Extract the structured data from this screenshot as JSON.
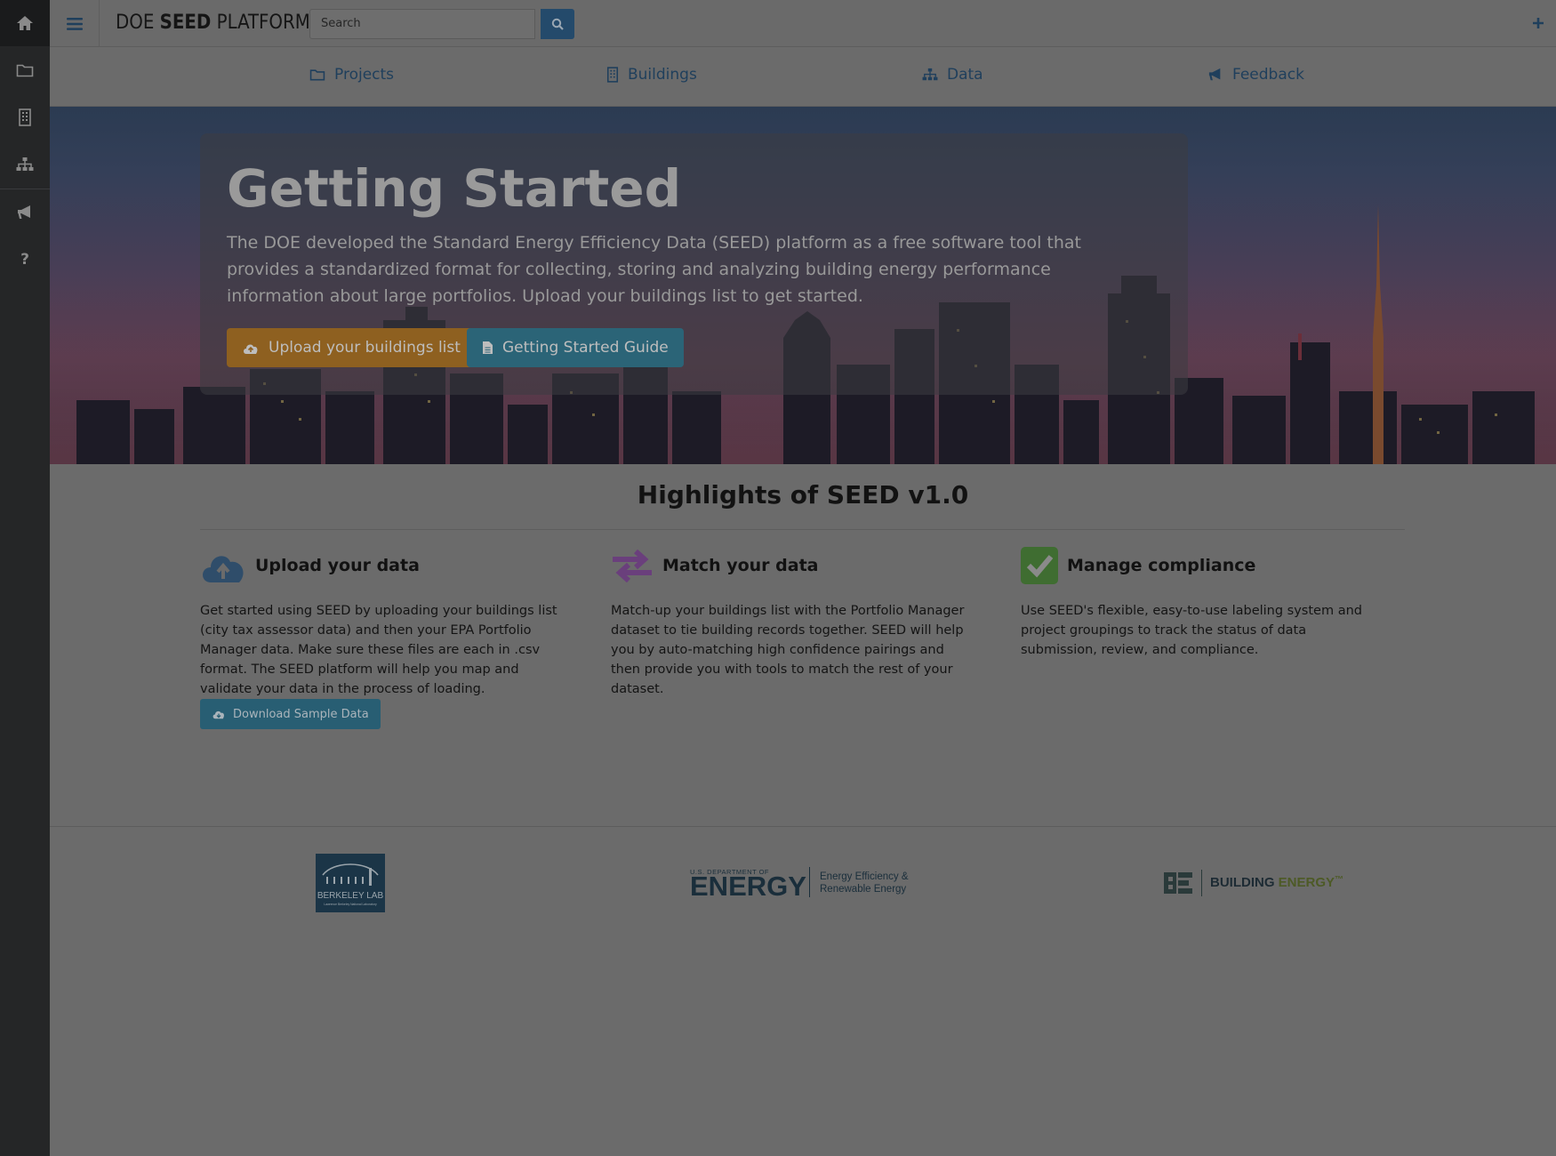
{
  "rail": {
    "items": [
      {
        "icon": "home-icon"
      },
      {
        "icon": "folder-icon"
      },
      {
        "icon": "building-icon"
      },
      {
        "icon": "sitemap-icon"
      },
      {
        "icon": "bullhorn-icon"
      },
      {
        "icon": "question-icon"
      }
    ]
  },
  "topbar": {
    "brand_prefix": "DOE ",
    "brand_bold": "SEED",
    "brand_suffix": " PLATFORM",
    "search_placeholder": "Search"
  },
  "nav": {
    "items": [
      {
        "label": "Projects",
        "icon": "folder-icon"
      },
      {
        "label": "Buildings",
        "icon": "building-icon"
      },
      {
        "label": "Data",
        "icon": "sitemap-icon"
      },
      {
        "label": "Feedback",
        "icon": "bullhorn-icon"
      }
    ]
  },
  "hero": {
    "title": "Getting Started",
    "text": "The DOE developed the Standard Energy Efficiency Data (SEED) platform as a free software tool that provides a standardized format for collecting, storing and analyzing building energy performance information about large portfolios. Upload your buildings list to get started.",
    "upload_label": "Upload your buildings list",
    "guide_label": "Getting Started Guide"
  },
  "highlights": {
    "title": "Highlights of SEED v1.0",
    "features": [
      {
        "title": "Upload your data",
        "text": "Get started using SEED by uploading your buildings list (city tax assessor data) and then your EPA Portfolio Manager data. Make sure these files are each in .csv format. The SEED platform will help you map and validate your data in the process of loading."
      },
      {
        "title": "Match your data",
        "text": "Match-up your buildings list with the Portfolio Manager dataset to tie building records together. SEED will help you by auto-matching high confidence pairings and then provide you with tools to match the rest of your dataset."
      },
      {
        "title": "Manage compliance",
        "text": "Use SEED's flexible, easy-to-use labeling system and project groupings to track the status of data submission, review, and compliance."
      }
    ],
    "sample_label": "Download Sample Data"
  },
  "footer": {
    "berkeley": "BERKELEY LAB",
    "berkeley_sub": "Lawrence Berkeley National Laboratory",
    "doe_top": "U.S. DEPARTMENT OF",
    "doe_main": "ENERGY",
    "doe_side1": "Energy Efficiency &",
    "doe_side2": "Renewable Energy",
    "be_word1": "BUILDING",
    "be_word2": "ENERGY",
    "be_tm": "™"
  },
  "colors": {
    "upload_icon": "#2f4d6a",
    "match_icon": "#6a3f7c",
    "check_bg": "#3f6d31"
  }
}
